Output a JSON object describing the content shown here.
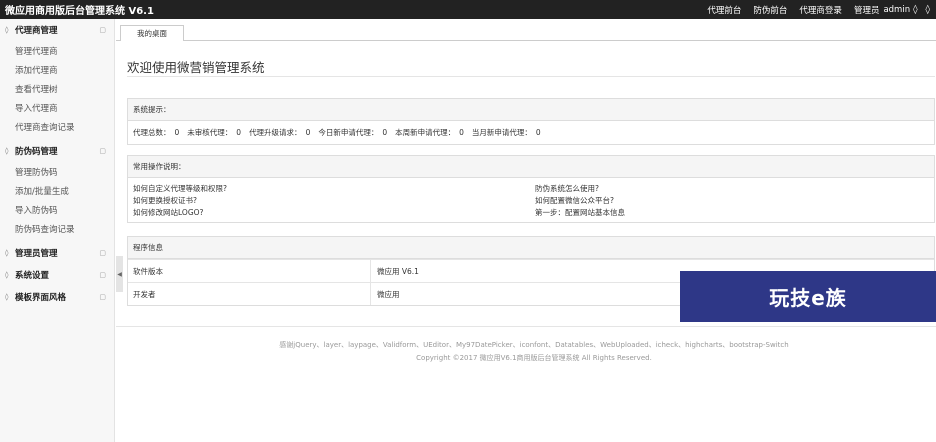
{
  "app": {
    "title": "微应用商用版后台管理系统 V6.1"
  },
  "topnav": {
    "link1": "代理前台",
    "link2": "防伪前台",
    "link3": "代理商登录",
    "role": "管理员",
    "user": "admin"
  },
  "sidebar": {
    "sections": [
      {
        "title": "代理商管理",
        "items": [
          "管理代理商",
          "添加代理商",
          "查看代理树",
          "导入代理商",
          "代理商查询记录"
        ]
      },
      {
        "title": "防伪码管理",
        "items": [
          "管理防伪码",
          "添加/批量生成",
          "导入防伪码",
          "防伪码查询记录"
        ]
      },
      {
        "title": "管理员管理",
        "items": []
      },
      {
        "title": "系统设置",
        "items": []
      },
      {
        "title": "模板界面风格",
        "items": []
      }
    ]
  },
  "tabs": {
    "desktop": "我的桌面"
  },
  "main": {
    "title": "欢迎使用微营销管理系统",
    "notice": {
      "header": "系统提示：",
      "stats": [
        {
          "label": "代理总数：",
          "value": "0"
        },
        {
          "label": "未审核代理：",
          "value": "0"
        },
        {
          "label": "代理升级请求：",
          "value": "0"
        },
        {
          "label": "今日新申请代理：",
          "value": "0"
        },
        {
          "label": "本周新申请代理：",
          "value": "0"
        },
        {
          "label": "当月新申请代理：",
          "value": "0"
        }
      ]
    },
    "ops": {
      "header": "常用操作说明：",
      "items": [
        "如何自定义代理等级和权限?",
        "防伪系统怎么使用?",
        "如何更换授权证书?",
        "如何配置微信公众平台?",
        "如何修改网站LOGO?",
        "第一步：配置网站基本信息"
      ]
    },
    "info": {
      "header": "程序信息",
      "rows": [
        {
          "key": "软件版本",
          "value": "微应用 V6.1"
        },
        {
          "key": "开发者",
          "value": "微应用"
        }
      ]
    }
  },
  "footer": {
    "credits": "感谢jQuery、layer、laypage、Validform、UEditor、My97DatePicker、iconfont、Datatables、WebUploaded、icheck、highcharts、bootstrap-Switch",
    "copyright": "Copyright ©2017 微应用V6.1商用版后台管理系统 All Rights Reserved."
  },
  "watermark": {
    "text": "玩技e族"
  }
}
